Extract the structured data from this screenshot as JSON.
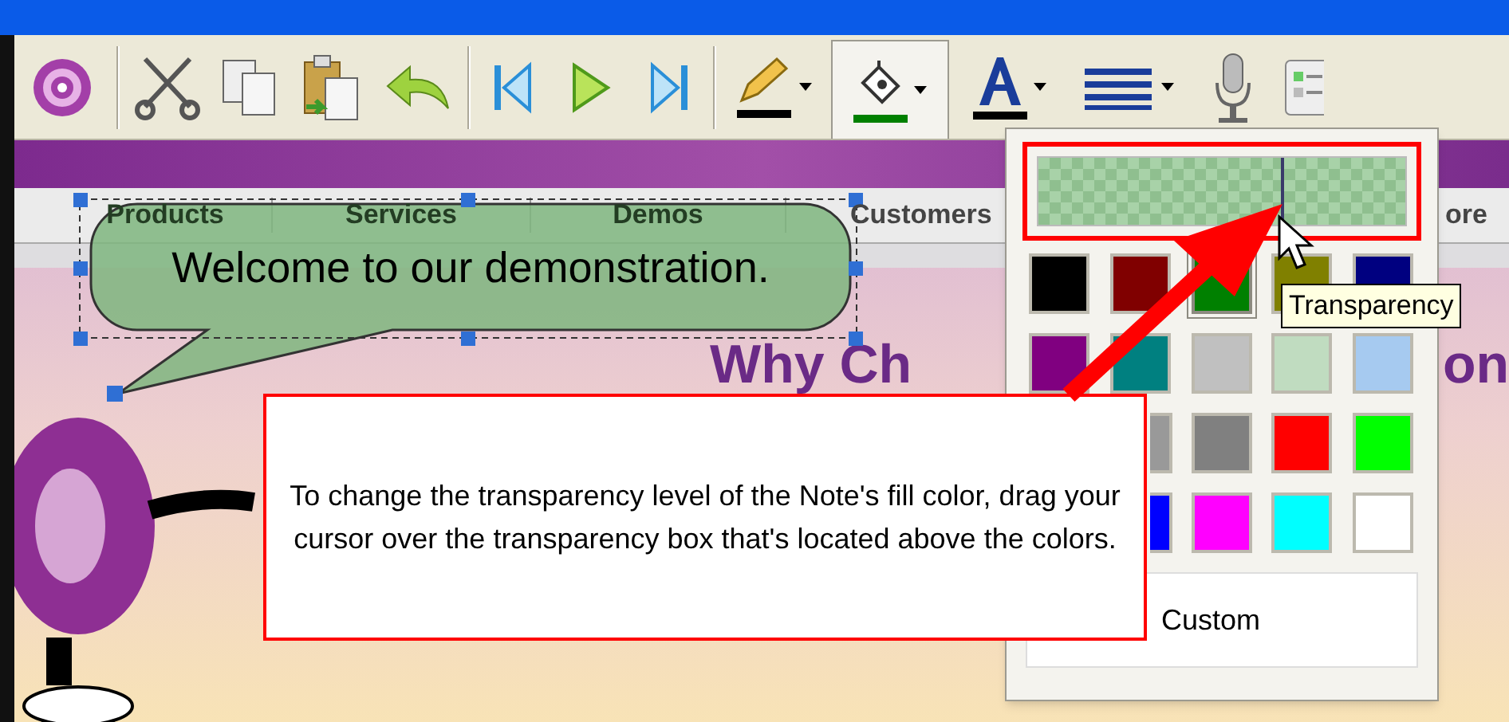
{
  "toolbar": {
    "buttons": [
      {
        "kind": "target",
        "selected": false
      },
      {
        "kind": "separator"
      },
      {
        "kind": "cut",
        "selected": false
      },
      {
        "kind": "copy",
        "selected": false
      },
      {
        "kind": "paste",
        "selected": false
      },
      {
        "kind": "undo",
        "selected": false
      },
      {
        "kind": "separator"
      },
      {
        "kind": "first",
        "selected": false
      },
      {
        "kind": "play",
        "selected": false
      },
      {
        "kind": "last",
        "selected": false
      },
      {
        "kind": "separator"
      },
      {
        "kind": "pencil",
        "selected": false,
        "color": "#000000"
      },
      {
        "kind": "bucket",
        "selected": true,
        "color": "#008000"
      },
      {
        "kind": "font",
        "selected": false,
        "color": "#000000"
      },
      {
        "kind": "lines",
        "selected": false
      },
      {
        "kind": "mic",
        "selected": false
      },
      {
        "kind": "panel",
        "selected": false
      }
    ]
  },
  "page": {
    "nav": [
      "Products",
      "Services",
      "Demos",
      "Customers",
      "ore"
    ],
    "heading": [
      "Why Ch",
      "on"
    ]
  },
  "note": {
    "text": "Welcome to our demonstration."
  },
  "callout": {
    "text": "To change the transparency level of the Note's fill color, drag your cursor over the transparency box that's located above the colors."
  },
  "fill_popup": {
    "transparency": {
      "level": 0.66
    },
    "swatches": [
      {
        "color": "#000000",
        "selected": false
      },
      {
        "color": "#800000",
        "selected": false
      },
      {
        "color": "#008000",
        "selected": true
      },
      {
        "color": "#808000",
        "selected": false
      },
      {
        "color": "#000080",
        "selected": false
      },
      {
        "color": "#800080",
        "selected": false
      },
      {
        "color": "#008080",
        "selected": false
      },
      {
        "color": "#c0c0c0",
        "selected": false
      },
      {
        "color": "#c0dcc0",
        "selected": false
      },
      {
        "color": "#a6caf0",
        "selected": false
      },
      {
        "color": "#999999",
        "kind": "clipped"
      },
      {
        "color": "#808080",
        "selected": false
      },
      {
        "color": "#ff0000",
        "selected": false
      },
      {
        "color": "#00ff00",
        "selected": false
      },
      {
        "color": "#0000ff",
        "kind": "clipped"
      },
      {
        "color": "#ff00ff",
        "selected": false
      },
      {
        "color": "#00ffff",
        "selected": false
      },
      {
        "color": "#ffffff",
        "selected": false
      }
    ],
    "custom_label": "Custom"
  },
  "tooltip": "Transparency"
}
